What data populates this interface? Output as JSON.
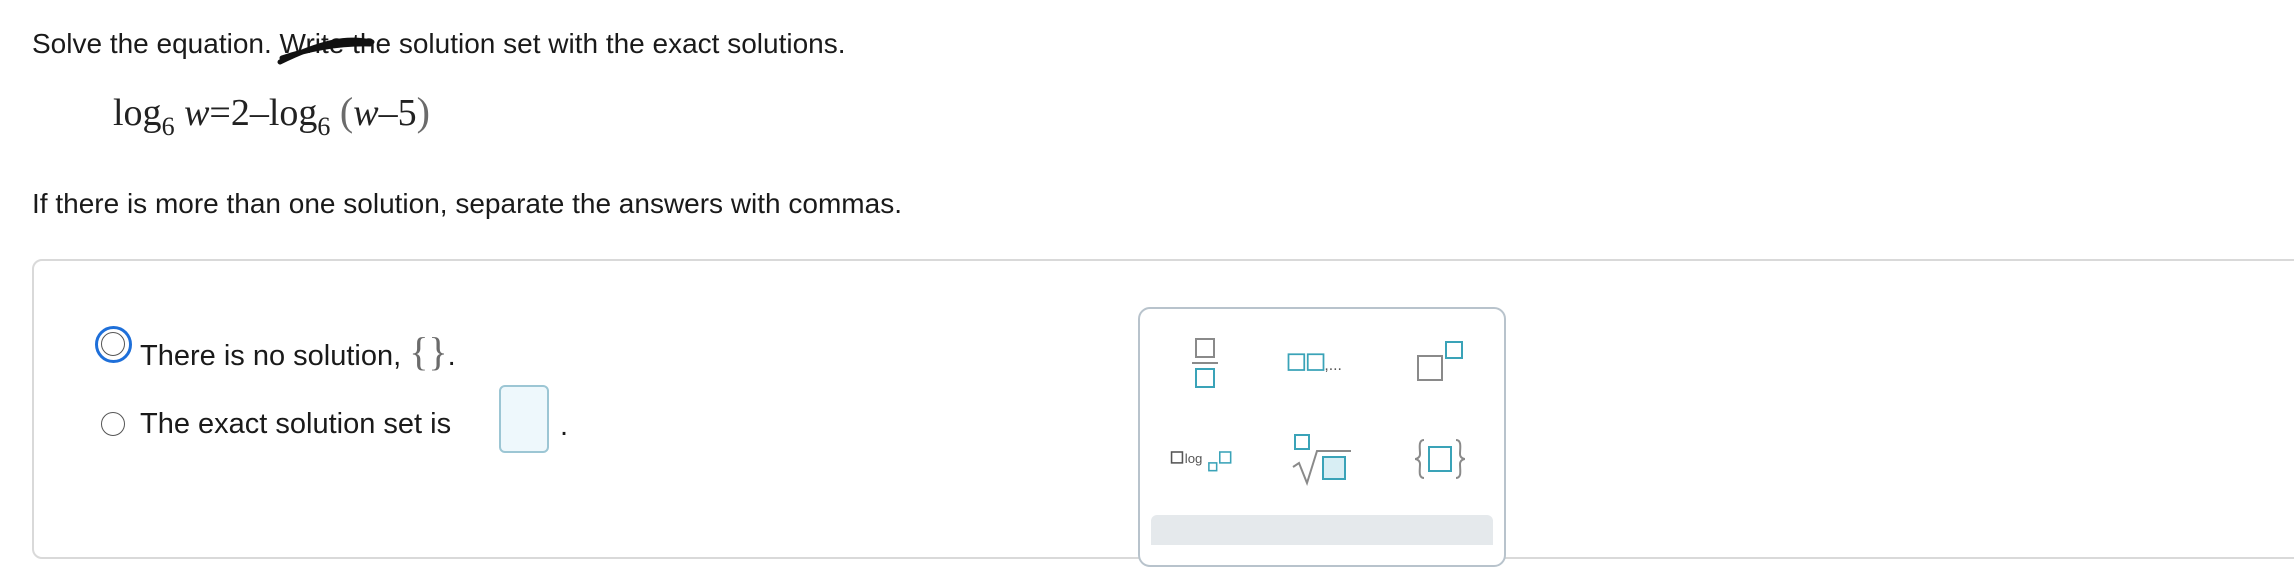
{
  "instructions": {
    "line1_prefix": "Solve the equation. ",
    "line1_struck_word": "Write",
    "line1_suffix": " the solution set with the exact solutions.",
    "line2": "If there is more than one solution, separate the answers with commas."
  },
  "equation": {
    "log_fn": "log",
    "base": "6",
    "lhs_var": "w",
    "equals": "=",
    "constant": "2",
    "minus": "–",
    "rhs_var": "w",
    "rhs_minus": "–",
    "rhs_const": "5",
    "open_paren": "(",
    "close_paren": ")"
  },
  "options": {
    "no_solution_label": "There is no solution, ",
    "empty_set_symbol": "{}",
    "no_solution_period": ".",
    "solution_set_label": "The exact solution set is",
    "solution_set_period": "."
  },
  "palette": {
    "tools": [
      "fraction-icon",
      "list-icon",
      "exponent-icon",
      "log-base-icon",
      "nth-root-icon",
      "set-braces-icon"
    ],
    "list_suffix": ",...",
    "log_text": "log"
  },
  "colors": {
    "focus_ring": "#1e6fd9",
    "template_box": "#3aa3b8",
    "input_fill": "#eef8fc",
    "input_border": "#9cc6d4"
  }
}
